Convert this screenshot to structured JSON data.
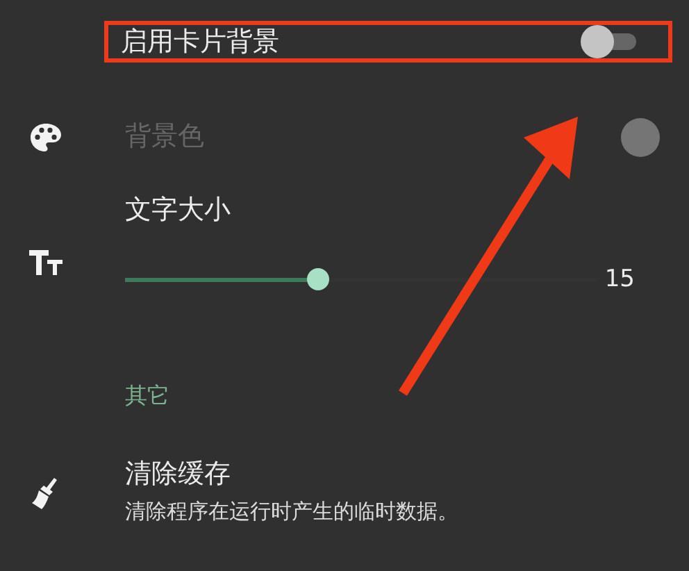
{
  "settings": [
    {
      "kind": "switch",
      "title": "启用卡片背景",
      "on": false,
      "highlighted": true
    },
    {
      "kind": "color",
      "title": "背景色",
      "disabled": true,
      "color": "#757575"
    },
    {
      "kind": "slider",
      "title": "文字大小",
      "level": 0.41,
      "reading": "15"
    },
    {
      "kind": "category",
      "title": "其它"
    },
    {
      "kind": "action",
      "title": "清除缓存",
      "summary": "清除程序在运行时产生的临时数据。"
    }
  ]
}
